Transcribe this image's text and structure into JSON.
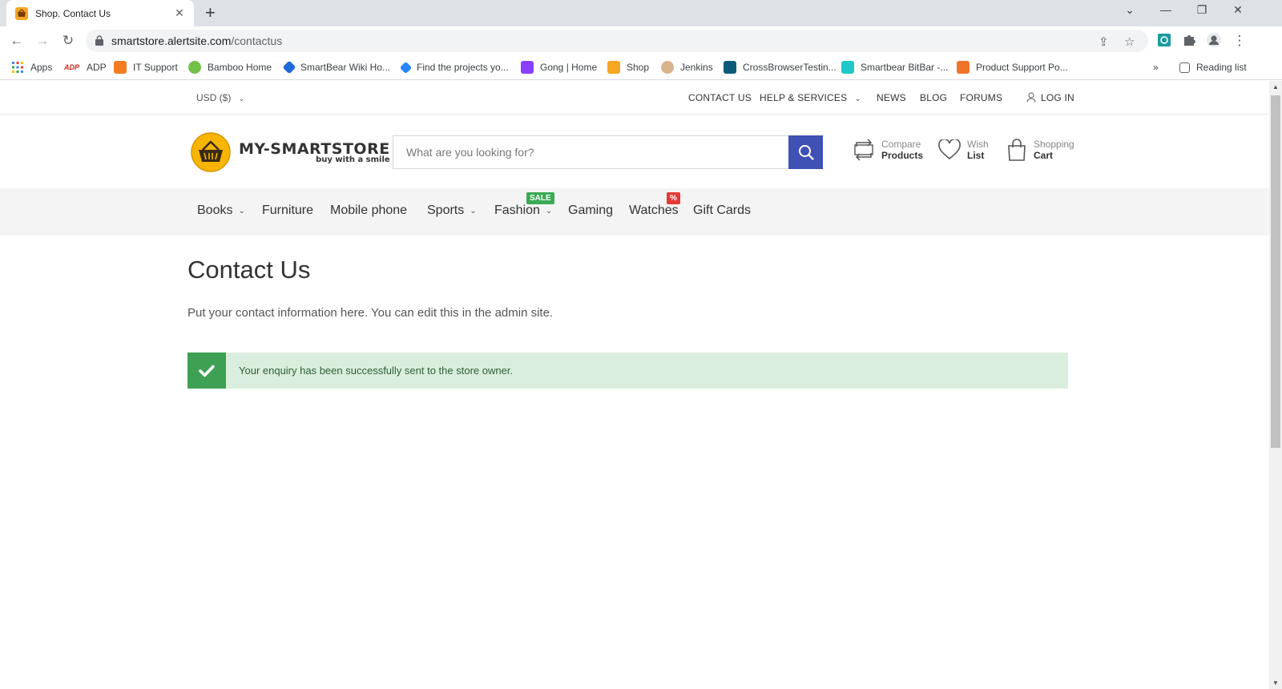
{
  "browser": {
    "tab_title": "Shop. Contact Us",
    "url_host": "smartstore.alertsite.com",
    "url_path": "/contactus",
    "bookmarks": [
      "Apps",
      "ADP",
      "IT Support",
      "Bamboo Home",
      "SmartBear Wiki Ho...",
      "Find the projects yo...",
      "Gong | Home",
      "Shop",
      "Jenkins",
      "CrossBrowserTestin...",
      "Smartbear BitBar -...",
      "Product Support Po..."
    ],
    "reading_list": "Reading list"
  },
  "topbar": {
    "currency": "USD ($)",
    "contact_us": "CONTACT US",
    "help_services": "HELP & SERVICES",
    "news": "NEWS",
    "blog": "BLOG",
    "forums": "FORUMS",
    "login": "LOG IN"
  },
  "header": {
    "brand_name": "MY-SMARTSTORE",
    "tagline": "buy with a smile",
    "search_placeholder": "What are you looking for?",
    "compare_line1": "Compare",
    "compare_line2": "Products",
    "wish_line1": "Wish",
    "wish_line2": "List",
    "cart_line1": "Shopping",
    "cart_line2": "Cart"
  },
  "menu": {
    "books": "Books",
    "furniture": "Furniture",
    "mobile": "Mobile phone",
    "sports": "Sports",
    "fashion": "Fashion",
    "fashion_badge": "SALE",
    "gaming": "Gaming",
    "watches": "Watches",
    "watches_badge": "%",
    "gift_cards": "Gift Cards"
  },
  "content": {
    "title": "Contact Us",
    "text": "Put your contact information here. You can edit this in the admin site.",
    "alert_message": "Your enquiry has been successfully sent to the store owner."
  },
  "colors": {
    "accent": "#3f51b5",
    "sale_badge": "#3aaa55",
    "percent_badge": "#e53935",
    "success_icon_bg": "#3ea053",
    "success_bg": "#d9eedc"
  }
}
